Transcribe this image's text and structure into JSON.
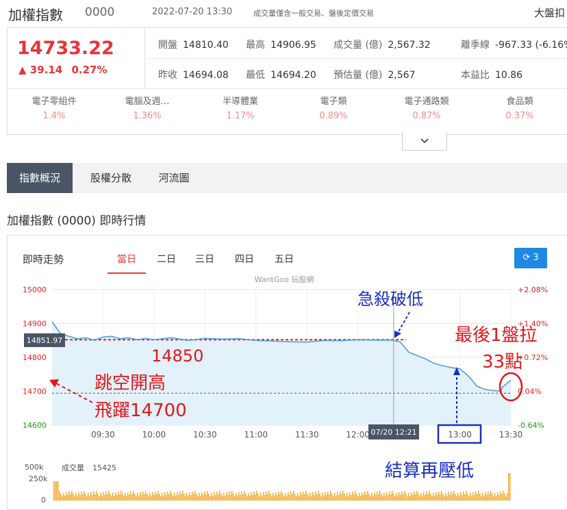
{
  "header": {
    "title": "加權指數",
    "code": "0000",
    "datetime": "2022-07-20 13:30",
    "note": "成交量僅含一般交易、盤後定價交易",
    "right_label": "大盤扣"
  },
  "quote": {
    "price": "14733.22",
    "change": "▲ 39.14",
    "change_pct": "0.27%",
    "stats": [
      {
        "label": "開盤",
        "value": "14810.40"
      },
      {
        "label": "最高",
        "value": "14906.95"
      },
      {
        "label": "成交量 (億)",
        "value": "2,567.32"
      },
      {
        "label": "離季線",
        "value": "-967.33 (-6.16%"
      },
      {
        "label": "昨收",
        "value": "14694.08"
      },
      {
        "label": "最低",
        "value": "14694.20"
      },
      {
        "label": "預估量 (億)",
        "value": "2,567"
      },
      {
        "label": "本益比",
        "value": "10.86"
      }
    ],
    "sectors": [
      {
        "name": "電子零組件",
        "pct": "1.4%"
      },
      {
        "name": "電腦及週…",
        "pct": "1.36%"
      },
      {
        "name": "半導體業",
        "pct": "1.17%"
      },
      {
        "name": "電子類",
        "pct": "0.89%"
      },
      {
        "name": "電子通路類",
        "pct": "0.87%"
      },
      {
        "name": "食品類",
        "pct": "0.37%"
      }
    ],
    "expand_icon": "chevron-down-icon"
  },
  "tabs": [
    "指數概況",
    "股權分散",
    "河流圖"
  ],
  "subtitle": "加權指數 (0000) 即時行情",
  "panel": {
    "title": "即時走勢",
    "range_tabs": [
      "當日",
      "二日",
      "三日",
      "四日",
      "五日"
    ],
    "refresh_label": "3",
    "refresh_icon": "refresh-icon",
    "watermark": "WantGoo 玩股網"
  },
  "chart_data": {
    "type": "line",
    "x_ticks": [
      "09:30",
      "10:00",
      "10:30",
      "11:00",
      "11:30",
      "12:00",
      "13:00",
      "13:30"
    ],
    "y_left_ticks": [
      "15000",
      "14900",
      "14800",
      "14700",
      "14600"
    ],
    "y_right_ticks": [
      "+2.08%",
      "+1.40%",
      "+0.72%",
      "0.04%",
      "-0.64%"
    ],
    "ylim": [
      14600,
      15000
    ],
    "prev_close": 14694.08,
    "cursor_value": "14851.97",
    "cursor_time": "07/20 12:21",
    "series": [
      {
        "x": [
          "09:00",
          "09:05",
          "09:10",
          "09:15",
          "09:20",
          "09:25",
          "09:30",
          "09:35",
          "09:40",
          "09:45",
          "09:50",
          "09:55",
          "10:00",
          "10:10",
          "10:20",
          "10:30",
          "10:40",
          "10:50",
          "11:00",
          "11:10",
          "11:20",
          "11:30",
          "11:40",
          "11:50",
          "12:00",
          "12:10",
          "12:20",
          "12:25",
          "12:30",
          "12:35",
          "12:40",
          "12:45",
          "12:50",
          "12:55",
          "13:00",
          "13:05",
          "13:10",
          "13:15",
          "13:20",
          "13:24",
          "13:25",
          "13:30"
        ],
        "values": [
          14905,
          14870,
          14862,
          14855,
          14858,
          14850,
          14860,
          14862,
          14855,
          14858,
          14852,
          14856,
          14852,
          14858,
          14850,
          14856,
          14854,
          14855,
          14850,
          14848,
          14846,
          14845,
          14850,
          14849,
          14852,
          14851,
          14851,
          14845,
          14815,
          14805,
          14795,
          14782,
          14775,
          14770,
          14766,
          14745,
          14715,
          14705,
          14702,
          14700,
          14712,
          14733
        ]
      }
    ],
    "volume": {
      "label": "成交量",
      "value": "15425",
      "y_ticks": [
        "500k",
        "250k",
        "0"
      ]
    },
    "annotations": [
      "急殺破低",
      "最後1盤拉",
      "33點",
      "跳空開高",
      "飛躍14700",
      "14850",
      "結算再壓低"
    ]
  }
}
